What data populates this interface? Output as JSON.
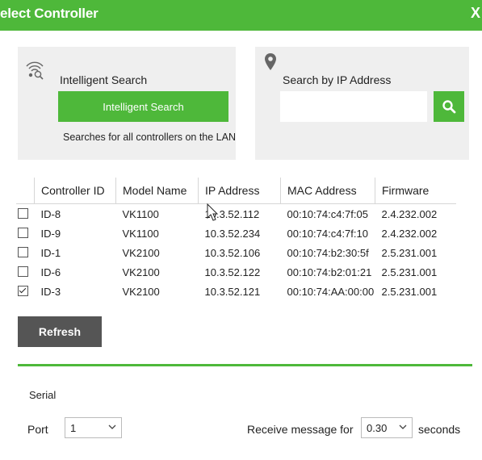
{
  "window": {
    "title": "elect Controller",
    "close_glyph": "X"
  },
  "intelligent_search": {
    "icon": "wifi-search-icon",
    "label": "Intelligent Search",
    "button_label": "Intelligent Search",
    "hint": "Searches for all controllers on the LAN"
  },
  "ip_search": {
    "icon": "location-pin-icon",
    "label": "Search by IP Address",
    "input_value": "",
    "button_icon": "magnifier-icon"
  },
  "table": {
    "headers": [
      "Controller ID",
      "Model Name",
      "IP Address",
      "MAC Address",
      "Firmware"
    ],
    "rows": [
      {
        "checked": false,
        "id": "ID-8",
        "model": "VK1100",
        "ip": "10.3.52.112",
        "mac": "00:10:74:c4:7f:05",
        "fw": "2.4.232.002"
      },
      {
        "checked": false,
        "id": "ID-9",
        "model": "VK1100",
        "ip": "10.3.52.234",
        "mac": "00:10:74:c4:7f:10",
        "fw": "2.4.232.002"
      },
      {
        "checked": false,
        "id": "ID-1",
        "model": "VK2100",
        "ip": "10.3.52.106",
        "mac": "00:10:74:b2:30:5f",
        "fw": "2.5.231.001"
      },
      {
        "checked": false,
        "id": "ID-6",
        "model": "VK2100",
        "ip": "10.3.52.122",
        "mac": "00:10:74:b2:01:21",
        "fw": "2.5.231.001"
      },
      {
        "checked": true,
        "id": "ID-3",
        "model": "VK2100",
        "ip": "10.3.52.121",
        "mac": "00:10:74:AA:00:00",
        "fw": "2.5.231.001"
      }
    ]
  },
  "refresh_label": "Refresh",
  "serial": {
    "section_label": "Serial",
    "port_label": "Port",
    "port_value": "1",
    "receive_label": "Receive message for",
    "receive_value": "0.30",
    "seconds_label": "seconds"
  },
  "colors": {
    "accent": "#4eb83a",
    "panel": "#efefef",
    "refresh": "#555555"
  }
}
